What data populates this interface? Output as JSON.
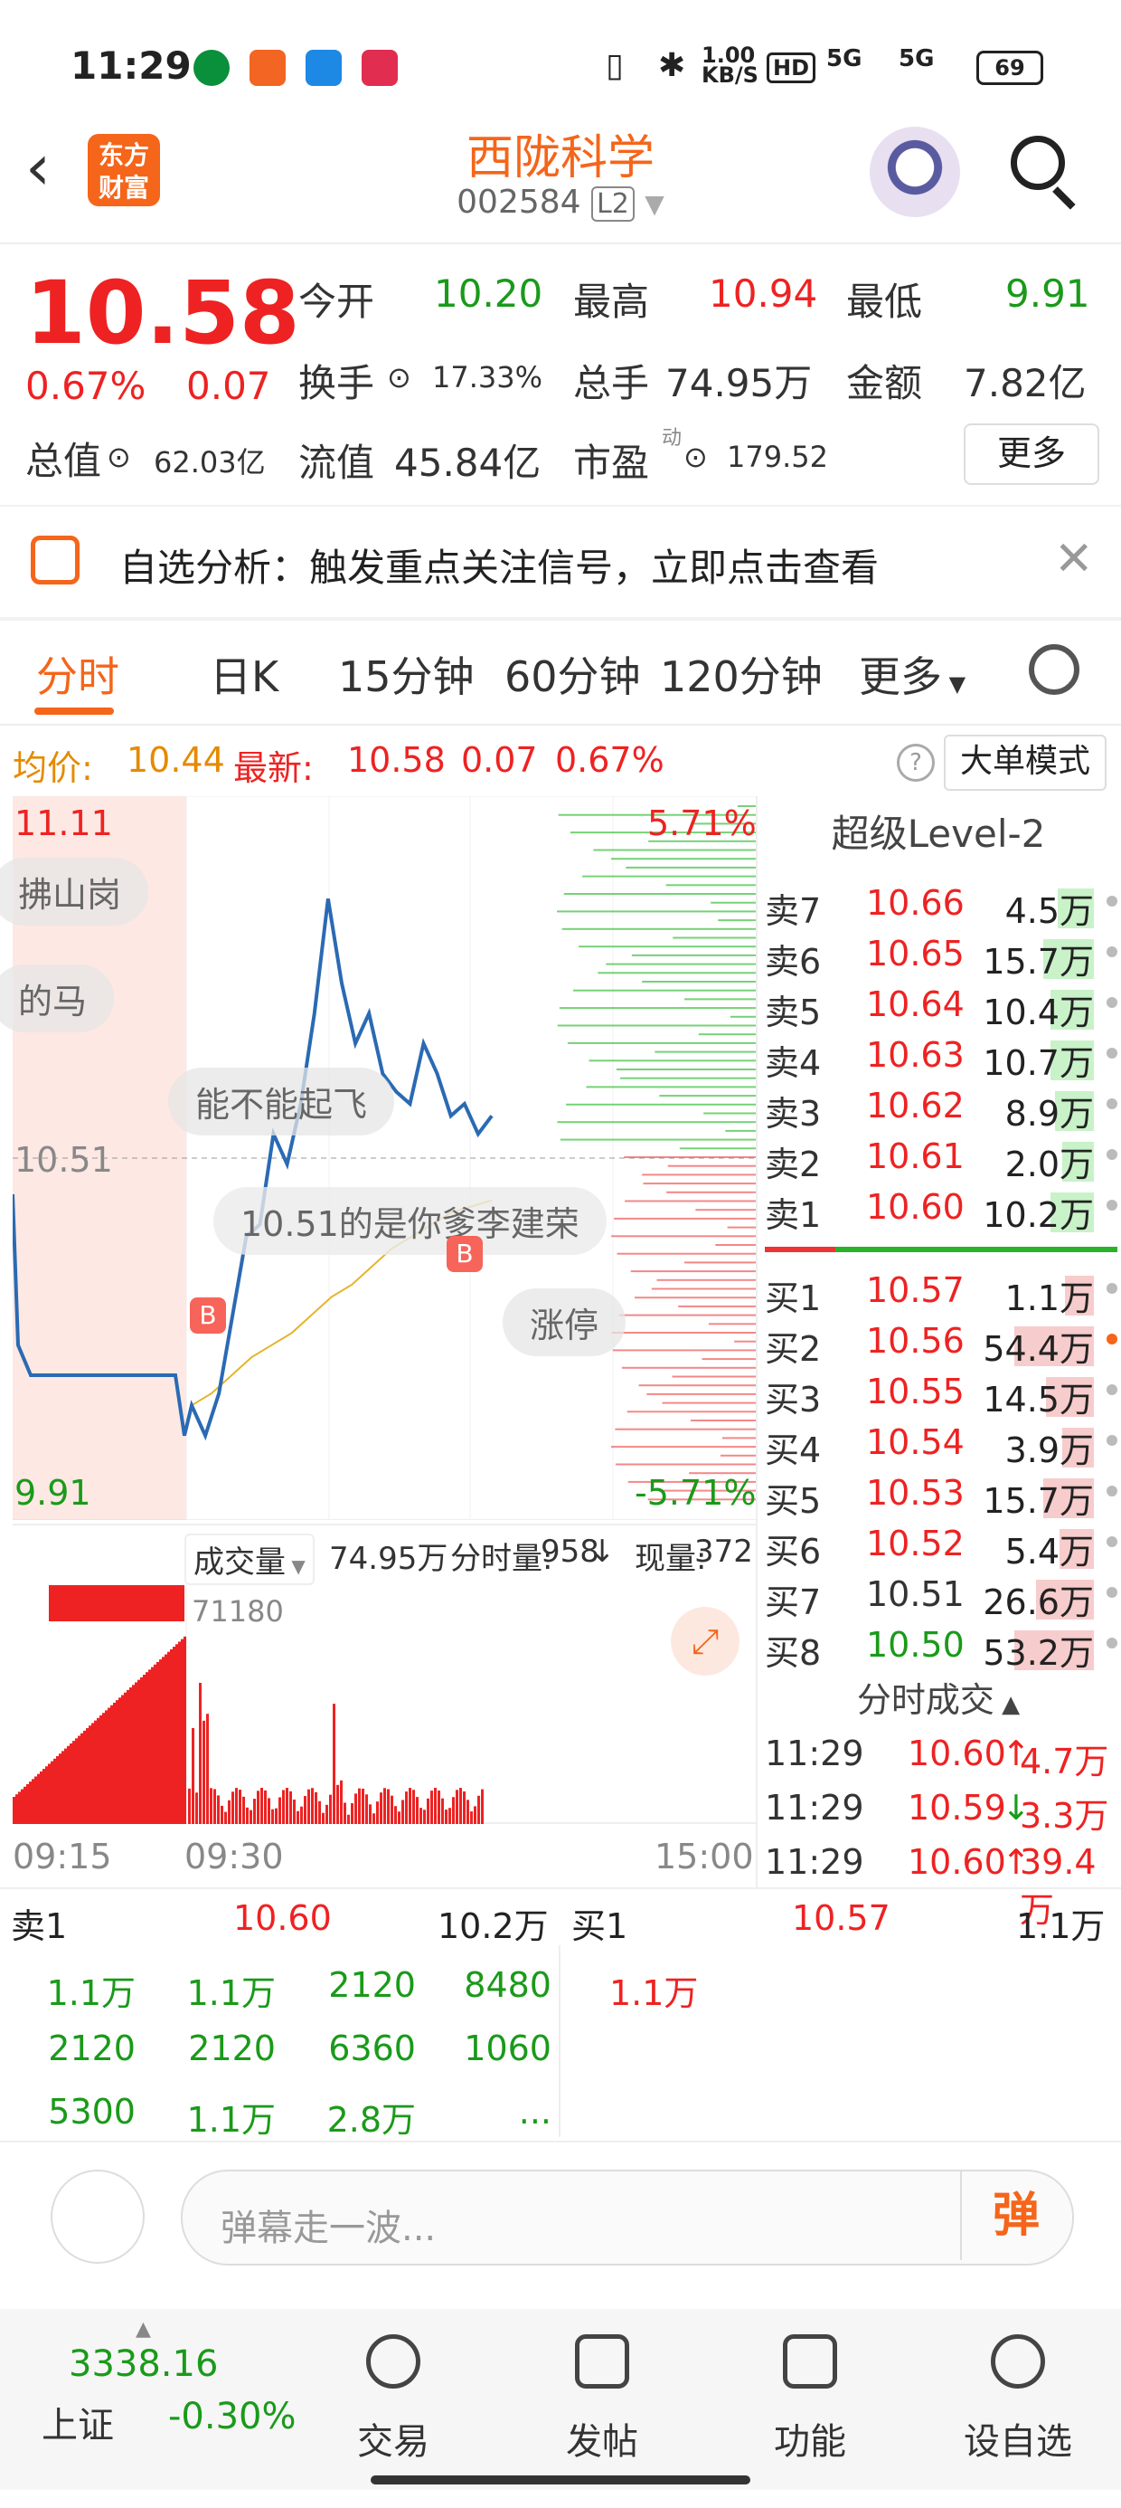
{
  "status_bar": {
    "time": "11:29",
    "network_speed": "1.00 KB/S",
    "hd": "HD",
    "signal_1": "5G",
    "signal_2": "5G",
    "battery": "69"
  },
  "header": {
    "back_glyph": "‹",
    "logo_line1": "东方",
    "logo_line2": "财富",
    "stock_name": "西陇科学",
    "stock_code": "002584",
    "level_badge": "L2"
  },
  "quote": {
    "price": "10.58",
    "change_pct": "0.67%",
    "change": "0.07",
    "open_label": "今开",
    "open": "10.20",
    "high_label": "最高",
    "high": "10.94",
    "low_label": "最低",
    "low": "9.91",
    "turnover_label": "换手",
    "turnover": "17.33%",
    "volume_label": "总手",
    "volume": "74.95万",
    "amount_label": "金额",
    "amount": "7.82亿",
    "mktcap_label": "总值",
    "mktcap": "62.03亿",
    "float_label": "流值",
    "float_cap": "45.84亿",
    "pe_label": "市盈",
    "pe_sup": "动",
    "pe": "179.52",
    "more_label": "更多"
  },
  "notice": {
    "text": "自选分析：触发重点关注信号，立即点击查看"
  },
  "tabs": [
    "分时",
    "日K",
    "15分钟",
    "60分钟",
    "120分钟",
    "更多"
  ],
  "chart_header": {
    "avg_label": "均价:",
    "avg": "10.44",
    "latest_label": "最新:",
    "latest": "10.58",
    "chg": "0.07",
    "chg_pct": "0.67%",
    "mode_button": "大单模式",
    "help": "?"
  },
  "chart_labels": {
    "high": "11.11",
    "low": "9.91",
    "pct_high": "5.71%",
    "pct_low": "-5.71%",
    "ref_price": "10.51",
    "limit_up_chip": "涨停"
  },
  "danmaku": [
    "拂山岗",
    "的马",
    "能不能起飞",
    "10.51的是你爹李建荣"
  ],
  "volume_header": {
    "label": "成交量",
    "total": "74.95万",
    "minute_label": "分时量:",
    "minute": "958",
    "now_label": "现量:",
    "now": "372",
    "peak": "71180"
  },
  "time_axis": [
    "09:15",
    "09:30",
    "15:00"
  ],
  "orderbook": {
    "title": "超级Level-2",
    "asks": [
      {
        "name": "卖7",
        "price": "10.66",
        "vol": "4.5万",
        "bar": 0.25
      },
      {
        "name": "卖6",
        "price": "10.65",
        "vol": "15.7万",
        "bar": 0.35
      },
      {
        "name": "卖5",
        "price": "10.64",
        "vol": "10.4万",
        "bar": 0.3
      },
      {
        "name": "卖4",
        "price": "10.63",
        "vol": "10.7万",
        "bar": 0.3
      },
      {
        "name": "卖3",
        "price": "10.62",
        "vol": "8.9万",
        "bar": 0.27
      },
      {
        "name": "卖2",
        "price": "10.61",
        "vol": "2.0万",
        "bar": 0.22
      },
      {
        "name": "卖1",
        "price": "10.60",
        "vol": "10.2万",
        "bar": 0.3
      }
    ],
    "bids": [
      {
        "name": "买1",
        "price": "10.57",
        "vol": "1.1万",
        "bar": 0.2
      },
      {
        "name": "买2",
        "price": "10.56",
        "vol": "54.4万",
        "bar": 0.55
      },
      {
        "name": "买3",
        "price": "10.55",
        "vol": "14.5万",
        "bar": 0.33
      },
      {
        "name": "买4",
        "price": "10.54",
        "vol": "3.9万",
        "bar": 0.22
      },
      {
        "name": "买5",
        "price": "10.53",
        "vol": "15.7万",
        "bar": 0.35
      },
      {
        "name": "买6",
        "price": "10.52",
        "vol": "5.4万",
        "bar": 0.24
      },
      {
        "name": "买7",
        "price": "10.51",
        "vol": "26.6万",
        "bar": 0.4
      },
      {
        "name": "买8",
        "price": "10.50",
        "vol": "53.2万",
        "bar": 0.55
      }
    ]
  },
  "trades": {
    "title": "分时成交",
    "rows": [
      {
        "time": "11:29",
        "price": "10.60",
        "arrow": "↑",
        "vol": "4.7万",
        "dir": "up"
      },
      {
        "time": "11:29",
        "price": "10.59",
        "arrow": "↓",
        "vol": "3.3万",
        "dir": "down"
      },
      {
        "time": "11:29",
        "price": "10.60",
        "arrow": "↑",
        "vol": "39.4万",
        "dir": "up"
      }
    ]
  },
  "bottom_book": {
    "sell_name": "卖1",
    "sell_price": "10.60",
    "sell_vol": "10.2万",
    "buy_name": "买1",
    "buy_price": "10.57",
    "buy_vol": "1.1万",
    "sell_queue": [
      "1.1万",
      "1.1万",
      "2120",
      "8480",
      "2120",
      "2120",
      "6360",
      "1060",
      "5300",
      "1.1万",
      "2.8万",
      "..."
    ],
    "buy_queue": [
      "1.1万"
    ]
  },
  "input": {
    "placeholder": "弹幕走一波...",
    "send_label": "弹"
  },
  "nav": {
    "index_value": "3338.16",
    "index_name": "上证",
    "index_chg": "-0.30%",
    "items": [
      "交易",
      "发帖",
      "功能",
      "设自选"
    ]
  },
  "chart_data": {
    "type": "line",
    "title": "",
    "ylim": [
      9.91,
      11.11
    ],
    "ref_price": 10.51,
    "x": [
      "09:15",
      "09:30",
      "15:00"
    ],
    "series": [
      {
        "name": "",
        "values": [
          10.45,
          10.18,
          10.15,
          10.1,
          10.05,
          10.12,
          10.25,
          10.38,
          10.4,
          10.55,
          10.5,
          10.6,
          10.75,
          10.94,
          10.8,
          10.7,
          10.75,
          10.65,
          10.62,
          10.6,
          10.7,
          10.65,
          10.58,
          10.6,
          10.55,
          10.58
        ]
      },
      {
        "name": "均价",
        "values": [
          10.1,
          10.12,
          10.15,
          10.18,
          10.2,
          10.22,
          10.25,
          10.28,
          10.3,
          10.33,
          10.36,
          10.38,
          10.4,
          10.42,
          10.43,
          10.44
        ]
      }
    ]
  }
}
